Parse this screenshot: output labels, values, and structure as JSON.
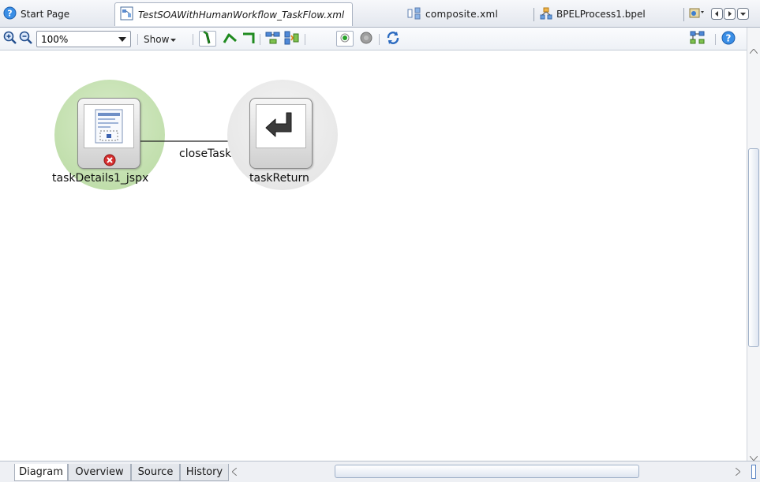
{
  "tabs": [
    {
      "label": "Start Page",
      "icon": "help-icon"
    },
    {
      "label": "TestSOAWithHumanWorkflow_TaskFlow.xml",
      "icon": "taskflow-file-icon"
    },
    {
      "label": "composite.xml",
      "icon": "composite-icon"
    },
    {
      "label": "BPELProcess1.bpel",
      "icon": "bpel-icon"
    }
  ],
  "toolbar": {
    "zoom_value": "100%",
    "show_label": "Show"
  },
  "diagram": {
    "nodes": [
      {
        "label": "taskDetails1_jspx",
        "icon": "page-icon",
        "status": "error-icon"
      },
      {
        "label": "taskReturn",
        "icon": "return-icon"
      }
    ],
    "edge_label": "closeTaskFl"
  },
  "bottom_tabs": [
    "Diagram",
    "Overview",
    "Source",
    "History"
  ],
  "colors": {
    "halo_green": "#c6e2b3",
    "halo_gray": "#e9e9e9",
    "error_red": "#d62f2f",
    "toolbar_green": "#1f8a1f"
  }
}
